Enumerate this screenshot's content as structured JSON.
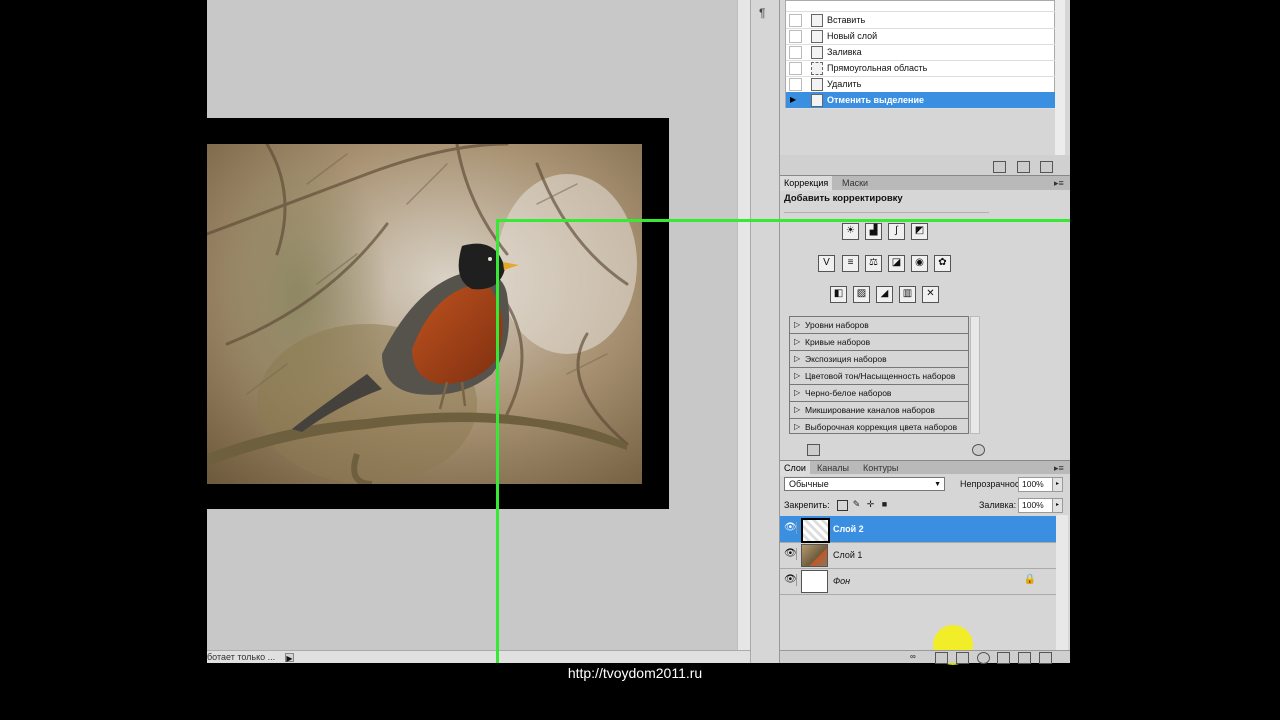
{
  "history": {
    "items": [
      {
        "label": "Вставить",
        "active": false
      },
      {
        "label": "Новый слой",
        "active": false
      },
      {
        "label": "Заливка",
        "active": false
      },
      {
        "label": "Прямоугольная область",
        "active": false
      },
      {
        "label": "Удалить",
        "active": false
      },
      {
        "label": "Отменить выделение",
        "active": true
      }
    ]
  },
  "corrections": {
    "tabs": [
      "Коррекция",
      "Маски"
    ],
    "title": "Добавить корректировку",
    "icon_rows": [
      [
        "brightness-icon",
        "levels-icon",
        "curves-icon",
        "exposure-icon"
      ],
      [
        "vibrance-icon",
        "hue-saturation-icon",
        "color-balance-icon",
        "black-white-icon",
        "photo-filter-icon",
        "channel-mixer-icon"
      ],
      [
        "invert-icon",
        "posterize-icon",
        "threshold-icon",
        "gradient-map-icon",
        "selective-color-icon"
      ]
    ],
    "presets": [
      "Уровни наборов",
      "Кривые наборов",
      "Экспозиция наборов",
      "Цветовой тон/Насыщенность наборов",
      "Черно-белое наборов",
      "Микширование каналов наборов",
      "Выборочная коррекция цвета наборов"
    ]
  },
  "layers_panel": {
    "tabs": [
      "Слои",
      "Каналы",
      "Контуры"
    ],
    "blend_mode": "Обычные",
    "opacity_label": "Непрозрачность:",
    "opacity_value": "100%",
    "lock_label": "Закрепить:",
    "fill_label": "Заливка:",
    "fill_value": "100%",
    "layers": [
      {
        "name": "Слой 2",
        "active": true,
        "thumb": "transparent",
        "locked": false
      },
      {
        "name": "Слой 1",
        "active": false,
        "thumb": "photo",
        "locked": false
      },
      {
        "name": "Фон",
        "active": false,
        "thumb": "white",
        "locked": true
      }
    ]
  },
  "status": {
    "text": "ботает только ..."
  },
  "watermark": {
    "url": "http://tvoydom2011.ru"
  },
  "colors": {
    "selection": "#35e935",
    "highlight": "#3a8fe0",
    "cursor_highlight": "#f4ef16"
  }
}
